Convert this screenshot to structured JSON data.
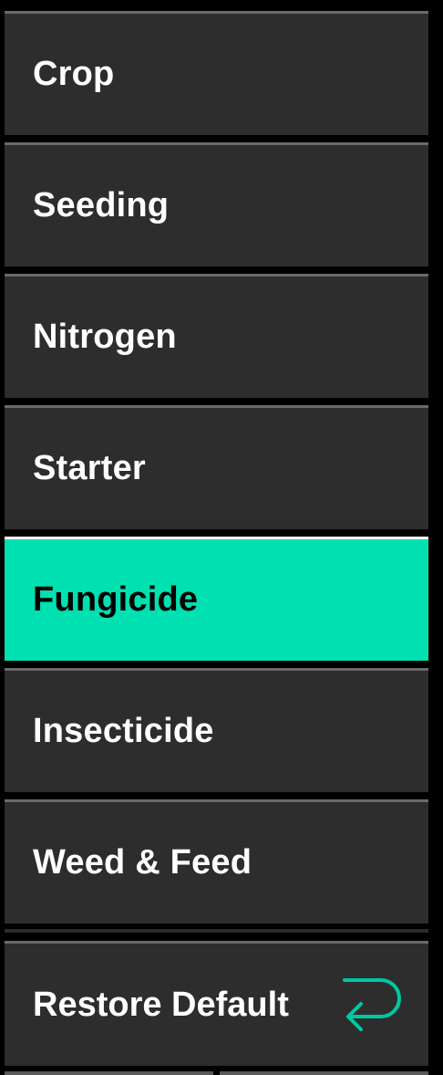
{
  "menu": {
    "items": [
      {
        "label": "Crop",
        "active": false
      },
      {
        "label": "Seeding",
        "active": false
      },
      {
        "label": "Nitrogen",
        "active": false
      },
      {
        "label": "Starter",
        "active": false
      },
      {
        "label": "Fungicide",
        "active": true
      },
      {
        "label": "Insecticide",
        "active": false
      },
      {
        "label": "Weed & Feed",
        "active": false
      }
    ]
  },
  "restore": {
    "label": "Restore Default",
    "icon": "return-arrow-icon"
  },
  "colors": {
    "background": "#000000",
    "item_bg": "#2d2d2d",
    "active_bg": "#00e0b0",
    "icon_accent": "#00c8a0"
  }
}
